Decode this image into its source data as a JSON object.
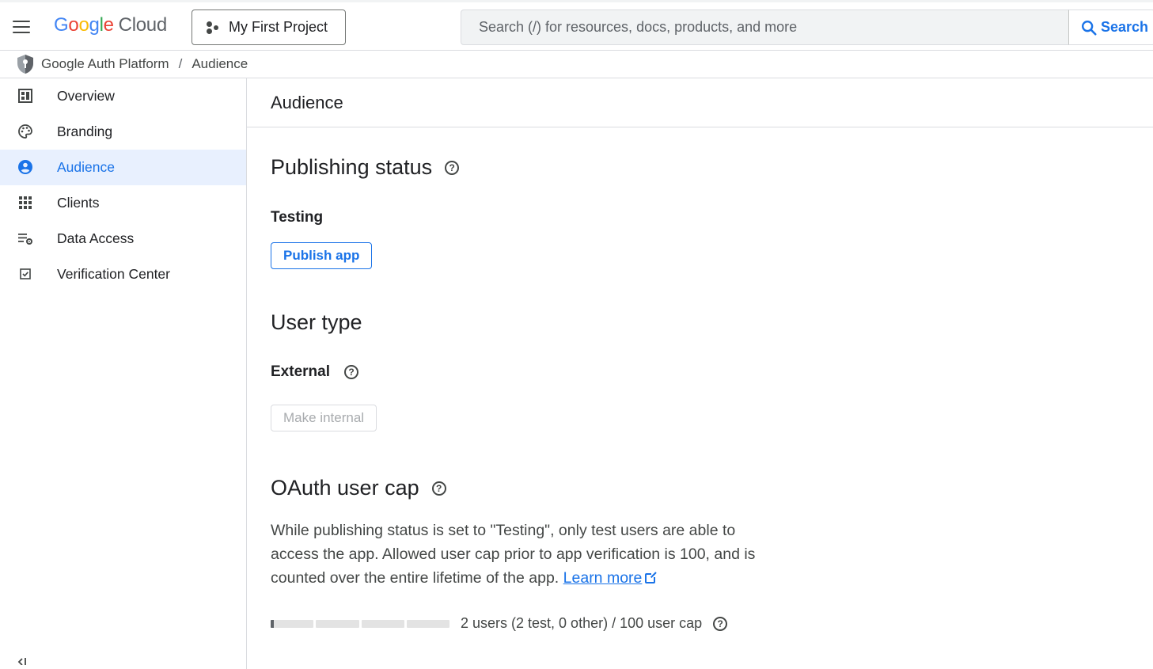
{
  "header": {
    "logo_google": [
      "G",
      "o",
      "o",
      "g",
      "l",
      "e"
    ],
    "logo_cloud": "Cloud",
    "project_name": "My First Project",
    "search_placeholder": "Search (/) for resources, docs, products, and more",
    "search_button": "Search"
  },
  "breadcrumb": {
    "product": "Google Auth Platform",
    "separator": "/",
    "current": "Audience"
  },
  "sidebar": {
    "items": [
      {
        "label": "Overview",
        "icon": "dashboard-icon"
      },
      {
        "label": "Branding",
        "icon": "palette-icon"
      },
      {
        "label": "Audience",
        "icon": "person-circle-icon",
        "active": true
      },
      {
        "label": "Clients",
        "icon": "apps-grid-icon"
      },
      {
        "label": "Data Access",
        "icon": "data-settings-icon"
      },
      {
        "label": "Verification Center",
        "icon": "checkbox-icon"
      }
    ]
  },
  "main": {
    "page_title": "Audience",
    "publishing": {
      "title": "Publishing status",
      "status": "Testing",
      "button": "Publish app"
    },
    "user_type": {
      "title": "User type",
      "value": "External",
      "button": "Make internal"
    },
    "oauth_cap": {
      "title": "OAuth user cap",
      "description": "While publishing status is set to \"Testing\", only test users are able to access the app. Allowed user cap prior to app verification is 100, and is counted over the entire lifetime of the app.",
      "learn_more": "Learn more",
      "usage_text": "2 users (2 test, 0 other) / 100 user cap",
      "users": 2,
      "cap": 100
    }
  },
  "colors": {
    "accent": "#1a73e8",
    "active_nav_bg": "#e8f0fe"
  }
}
